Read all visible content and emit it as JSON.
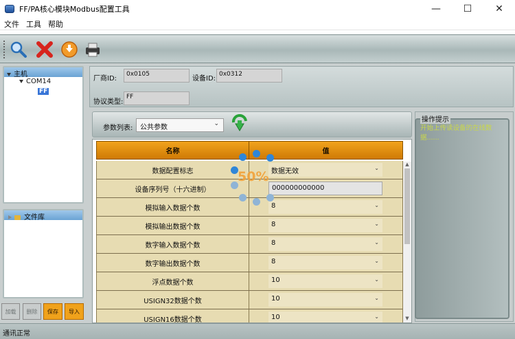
{
  "window": {
    "title": "FF/PA核心模块Modbus配置工具",
    "min_glyph": "—",
    "max_glyph": "☐",
    "close_glyph": "✕"
  },
  "menu": [
    "文件",
    "工具",
    "帮助"
  ],
  "toolbar": {
    "icons": [
      "search-icon",
      "delete-x-icon",
      "download-arrow-icon",
      "printer-icon"
    ]
  },
  "tree": {
    "host": "主机",
    "port": "COM14",
    "device": "FF",
    "library": "文件库"
  },
  "left_buttons": {
    "load": "加载",
    "delete": "删除",
    "save": "保存",
    "import": "导入"
  },
  "device_info": {
    "vendor_label": "厂商ID:",
    "vendor_value": "0x0105",
    "device_label": "设备ID:",
    "device_value": "0x0312",
    "protocol_label": "协议类型:",
    "protocol_value": "FF"
  },
  "params": {
    "list_label": "参数列表:",
    "selected": "公共参数"
  },
  "table": {
    "headers": [
      "名称",
      "值"
    ],
    "rows": [
      {
        "name": "数据配置标志",
        "value": "数据无效",
        "kind": "select"
      },
      {
        "name": "设备序列号（十六进制）",
        "value": "000000000000",
        "kind": "input"
      },
      {
        "name": "模拟输入数据个数",
        "value": "8",
        "kind": "select"
      },
      {
        "name": "模拟输出数据个数",
        "value": "8",
        "kind": "select"
      },
      {
        "name": "数字输入数据个数",
        "value": "8",
        "kind": "select"
      },
      {
        "name": "数字输出数据个数",
        "value": "8",
        "kind": "select"
      },
      {
        "name": "浮点数据个数",
        "value": "10",
        "kind": "select"
      },
      {
        "name": "USIGN32数据个数",
        "value": "10",
        "kind": "select"
      },
      {
        "name": "USIGN16数据个数",
        "value": "10",
        "kind": "select"
      }
    ]
  },
  "loading": {
    "percent": "50%"
  },
  "hint": {
    "title": "操作提示",
    "text": "开始上传读设备的在线数据......"
  },
  "status": {
    "text": "通讯正常"
  },
  "colors": {
    "accent_orange": "#f0a21b",
    "loader_blue": "#2f86d8",
    "hint_text": "#c9d74a",
    "tree_header": "#6aa3d4"
  }
}
